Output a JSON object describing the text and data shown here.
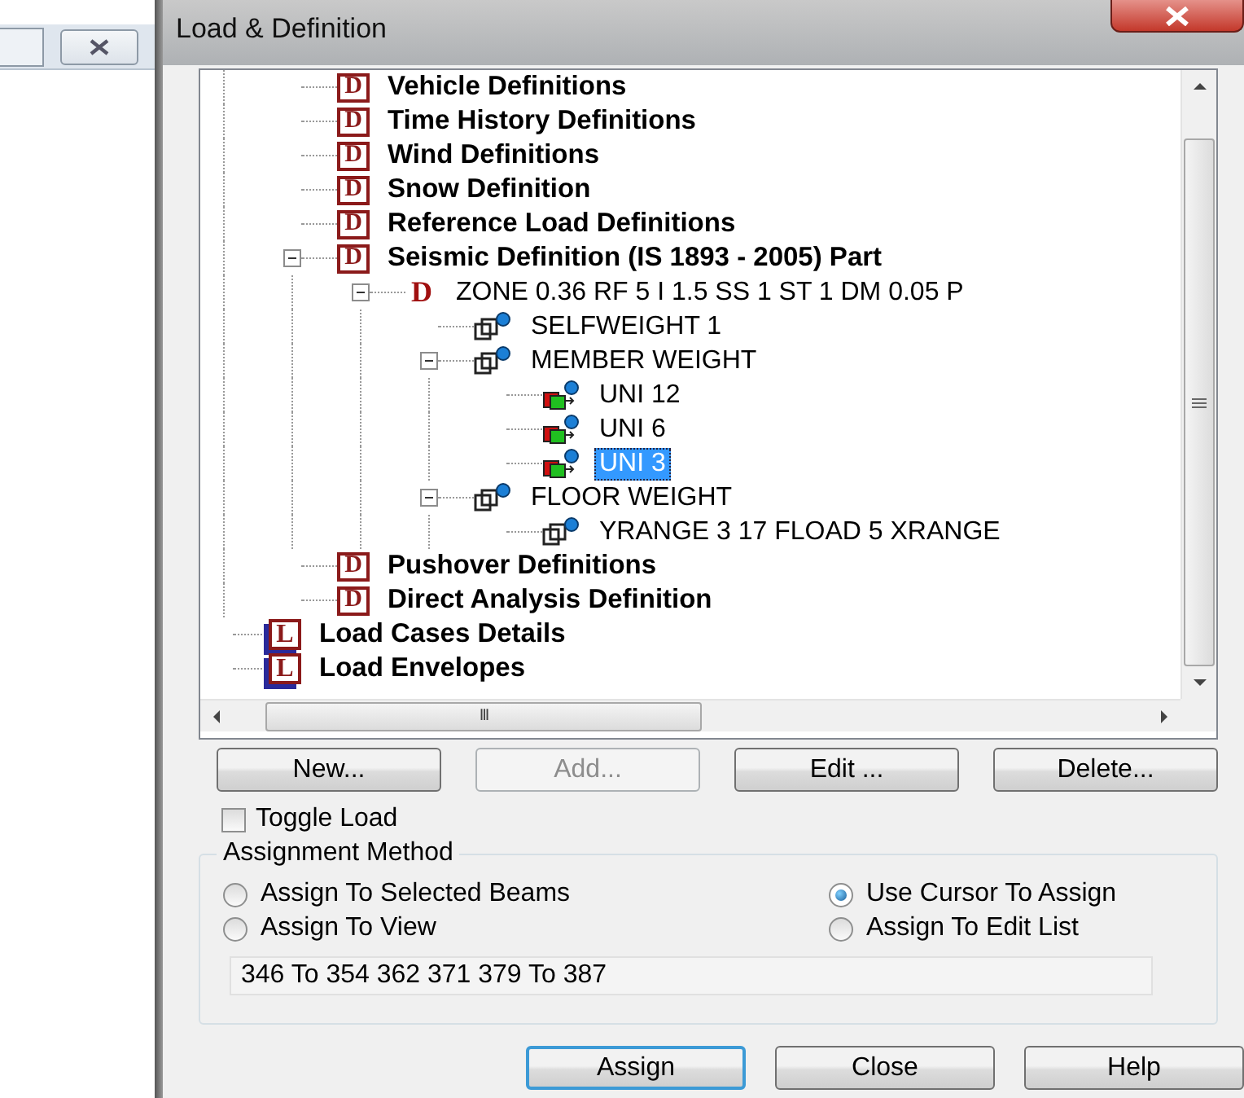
{
  "window": {
    "title": "Load & Definition"
  },
  "tree": [
    {
      "children": [
        {
          "kind": "definition",
          "badge": "D",
          "label": "Vehicle Definitions",
          "selected": false
        },
        {
          "kind": "definition",
          "badge": "D",
          "label": "Time History Definitions",
          "selected": false
        },
        {
          "kind": "definition",
          "badge": "D",
          "label": "Wind Definitions",
          "selected": false
        },
        {
          "kind": "definition",
          "badge": "D",
          "label": "Snow Definition",
          "selected": false
        },
        {
          "kind": "definition",
          "badge": "D",
          "label": "Reference Load Definitions",
          "selected": false
        },
        {
          "kind": "definition",
          "badge": "D",
          "label": "Seismic Definition (IS 1893 - 2005) Part",
          "selected": false,
          "expanded": true,
          "children": [
            {
              "kind": "zone",
              "badge": "D",
              "label": "ZONE 0.36 RF 5 I 1.5 SS 1 ST 1 DM 0.05 P",
              "selected": false,
              "expanded": true,
              "children": [
                {
                  "kind": "load",
                  "label": "SELFWEIGHT 1",
                  "selected": false
                },
                {
                  "kind": "load",
                  "label": "MEMBER WEIGHT",
                  "selected": false,
                  "expanded": true,
                  "children": [
                    {
                      "kind": "load_item",
                      "label": "UNI 12",
                      "selected": false
                    },
                    {
                      "kind": "load_item",
                      "label": "UNI 6",
                      "selected": false
                    },
                    {
                      "kind": "load_item",
                      "label": "UNI 3",
                      "selected": true
                    }
                  ]
                },
                {
                  "kind": "load",
                  "label": "FLOOR WEIGHT",
                  "selected": false,
                  "expanded": true,
                  "children": [
                    {
                      "kind": "load",
                      "label": "YRANGE 3 17 FLOAD 5 XRANGE",
                      "selected": false
                    }
                  ]
                }
              ]
            }
          ]
        },
        {
          "kind": "definition",
          "badge": "D",
          "label": "Pushover Definitions",
          "selected": false
        },
        {
          "kind": "definition",
          "badge": "D",
          "label": "Direct Analysis Definition",
          "selected": false
        }
      ]
    },
    {
      "kind": "load_case",
      "badge": "L",
      "label": "Load Cases Details",
      "selected": false
    },
    {
      "kind": "load_case",
      "badge": "L",
      "label": "Load Envelopes",
      "selected": false
    }
  ],
  "scrollbar_label": "III",
  "buttons": [
    {
      "label": "New...",
      "disabled": false
    },
    {
      "label": "Add...",
      "disabled": true
    },
    {
      "label": "Edit ...",
      "disabled": false
    },
    {
      "label": "Delete...",
      "disabled": false
    }
  ],
  "toggle_load": {
    "label": "Toggle Load",
    "checked": false
  },
  "assignment_method": {
    "title": "Assignment Method",
    "options": [
      {
        "label": "Assign To Selected Beams",
        "selected": false
      },
      {
        "label": "Use Cursor To Assign",
        "selected": true
      },
      {
        "label": "Assign To View",
        "selected": false
      },
      {
        "label": "Assign To Edit List",
        "selected": false
      }
    ],
    "list": "346 To 354 362 371 379 To 387"
  },
  "footer_buttons": [
    {
      "label": "Assign",
      "default": true
    },
    {
      "label": "Close",
      "default": false
    },
    {
      "label": "Help",
      "default": false
    }
  ]
}
